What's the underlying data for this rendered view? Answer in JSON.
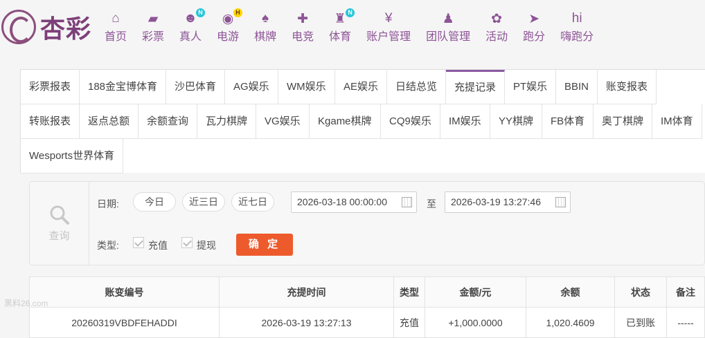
{
  "brand": {
    "logo_text": "杏彩"
  },
  "nav": [
    {
      "label": "首页",
      "icon": "home-icon",
      "glyph": "⌂"
    },
    {
      "label": "彩票",
      "icon": "lottery-icon",
      "glyph": "▰"
    },
    {
      "label": "真人",
      "icon": "live-dealer-icon",
      "glyph": "☻",
      "badge": "N"
    },
    {
      "label": "电游",
      "icon": "slot-game-icon",
      "glyph": "◉",
      "badge": "H"
    },
    {
      "label": "棋牌",
      "icon": "cards-icon",
      "glyph": "♠"
    },
    {
      "label": "电竞",
      "icon": "gamepad-icon",
      "glyph": "✚"
    },
    {
      "label": "体育",
      "icon": "trophy-icon",
      "glyph": "♜",
      "badge": "N"
    },
    {
      "label": "账户管理",
      "icon": "account-icon",
      "glyph": "¥"
    },
    {
      "label": "团队管理",
      "icon": "team-icon",
      "glyph": "♟"
    },
    {
      "label": "活动",
      "icon": "gift-icon",
      "glyph": "✿"
    },
    {
      "label": "跑分",
      "icon": "running-score-icon",
      "glyph": "➤"
    },
    {
      "label": "嗨跑分",
      "icon": "hi-icon",
      "glyph": "hi"
    }
  ],
  "tabs": [
    "彩票报表",
    "188金宝博体育",
    "沙巴体育",
    "AG娱乐",
    "WM娱乐",
    "AE娱乐",
    "日结总览",
    "充提记录",
    "PT娱乐",
    "BBIN",
    "账变报表",
    "转账报表",
    "返点总额",
    "余额查询",
    "瓦力棋牌",
    "VG娱乐",
    "Kgame棋牌",
    "CQ9娱乐",
    "IM娱乐",
    "YY棋牌",
    "FB体育",
    "奥丁棋牌",
    "IM体育",
    "Wesports世界体育"
  ],
  "active_tab": "充提记录",
  "query": {
    "side_label": "查询",
    "date_label": "日期:",
    "presets": [
      "今日",
      "近三日",
      "近七日"
    ],
    "start": "2026-03-18 00:00:00",
    "to": "至",
    "end": "2026-03-19 13:27:46",
    "type_label": "类型:",
    "types": [
      "充值",
      "提现"
    ],
    "confirm": "确 定"
  },
  "table": {
    "headers": [
      "账变编号",
      "充提时间",
      "类型",
      "金额/元",
      "余额",
      "状态",
      "备注"
    ],
    "rows": [
      [
        "20260319VBDFEHADDI",
        "2026-03-19 13:27:13",
        "充值",
        "+1,000.0000",
        "1,020.4609",
        "已到账",
        "-----"
      ]
    ]
  },
  "watermark": "黑料26.com"
}
